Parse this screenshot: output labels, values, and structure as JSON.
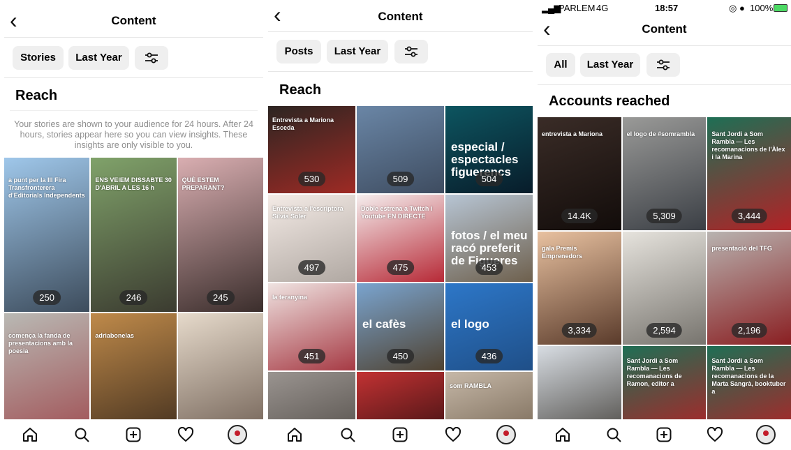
{
  "screens": [
    {
      "title": "Content",
      "filters": [
        "Stories",
        "Last Year"
      ],
      "section": "Reach",
      "note": "Your stories are shown to your audience for 24 hours. After 24 hours, stories appear here so you can view insights. These insights are only visible to you.",
      "tiles": [
        {
          "value": "250",
          "caption": "a punt per la III Fira Transfronterera d'Editorials Independents",
          "big": "",
          "colors": [
            "#9fc7ea",
            "#3d4c5c"
          ]
        },
        {
          "value": "246",
          "caption": "ENS VEIEM DISSABTE 30 D'ABRIL A LES 16 h",
          "big": "",
          "colors": [
            "#80a26a",
            "#3b3b30"
          ]
        },
        {
          "value": "245",
          "caption": "QUÈ ESTEM PREPARANT?",
          "big": "",
          "colors": [
            "#d9aeb1",
            "#3b2e2c"
          ]
        },
        {
          "value": "",
          "caption": "comença la fanda de presentacions amb la poesia",
          "big": "",
          "colors": [
            "#b9b9b4",
            "#9b3b41"
          ]
        },
        {
          "value": "",
          "caption": "adriabonelas",
          "big": "",
          "colors": [
            "#bf8a4a",
            "#2c1f16"
          ]
        },
        {
          "value": "",
          "caption": "",
          "big": "",
          "colors": [
            "#e6dacb",
            "#5b4a3f"
          ]
        }
      ]
    },
    {
      "title": "Content",
      "filters": [
        "Posts",
        "Last Year"
      ],
      "section": "Reach",
      "tiles": [
        {
          "value": "530",
          "caption": "Entrevista a Mariona Esceda",
          "big": "",
          "colors": [
            "#2c2522",
            "#9e2a24"
          ]
        },
        {
          "value": "509",
          "caption": "",
          "big": "",
          "colors": [
            "#6a86a6",
            "#3e4c60"
          ]
        },
        {
          "value": "504",
          "caption": "",
          "big": "especial / espectacles figuerencs",
          "colors": [
            "#0d5560",
            "#081c2a"
          ]
        },
        {
          "value": "497",
          "caption": "Entrevista a l'escriptora Sílvia Soler",
          "big": "",
          "colors": [
            "#f4ebe6",
            "#b0a8a2"
          ]
        },
        {
          "value": "475",
          "caption": "Doble estrena a Twitch i Youtube EN DIRECTE",
          "big": "",
          "colors": [
            "#f5eeee",
            "#b72a37"
          ]
        },
        {
          "value": "453",
          "caption": "",
          "big": "fotos / el meu racó preferit de Figueres",
          "colors": [
            "#b7c5d4",
            "#6e604d"
          ]
        },
        {
          "value": "451",
          "caption": "la teranyina",
          "big": "",
          "colors": [
            "#efe3e1",
            "#a63a44"
          ]
        },
        {
          "value": "450",
          "caption": "",
          "big": "el cafès",
          "colors": [
            "#7aa4cf",
            "#4f4231"
          ]
        },
        {
          "value": "436",
          "caption": "",
          "big": "el logo",
          "colors": [
            "#2d77c8",
            "#1f4f88"
          ]
        },
        {
          "value": "",
          "caption": "",
          "big": "",
          "colors": [
            "#9a9490",
            "#4a4540"
          ]
        },
        {
          "value": "",
          "caption": "",
          "big": "",
          "colors": [
            "#c23233",
            "#260b0c"
          ]
        },
        {
          "value": "",
          "caption": "som RAMBLA",
          "big": "",
          "colors": [
            "#c6b8a8",
            "#6a5a47"
          ]
        }
      ]
    },
    {
      "status": {
        "carrier": "PARLEM",
        "network": "4G",
        "time": "18:57",
        "battery": "100%"
      },
      "title": "Content",
      "filters": [
        "All",
        "Last Year"
      ],
      "section": "Accounts reached",
      "tiles": [
        {
          "value": "14.4K",
          "caption": "entrevista a Mariona",
          "big": "",
          "colors": [
            "#3a2c27",
            "#120c0a"
          ]
        },
        {
          "value": "5,309",
          "caption": "el logo de #somrambla",
          "big": "",
          "colors": [
            "#9a9a98",
            "#3b3f45"
          ]
        },
        {
          "value": "3,444",
          "caption": "Sant Jordi a Som Rambla — Les recomanacions de l'Àlex i la Marina",
          "big": "",
          "colors": [
            "#1e6f55",
            "#b22226"
          ]
        },
        {
          "value": "3,334",
          "caption": "gala Premis Emprenedors",
          "big": "",
          "colors": [
            "#e8c1a0",
            "#5a3b2b"
          ]
        },
        {
          "value": "2,594",
          "caption": "",
          "big": "",
          "colors": [
            "#e6e3dd",
            "#77746e"
          ]
        },
        {
          "value": "2,196",
          "caption": "presentació del TFG",
          "big": "",
          "colors": [
            "#b8b3b0",
            "#8a1f22"
          ]
        },
        {
          "value": "",
          "caption": "",
          "big": "",
          "colors": [
            "#d8dde3",
            "#4d4a45"
          ]
        },
        {
          "value": "",
          "caption": "Sant Jordi a Som Rambla — Les recomanacions de Ramon, editor a",
          "big": "",
          "colors": [
            "#1e6f55",
            "#b22226"
          ]
        },
        {
          "value": "",
          "caption": "Sant Jordi a Som Rambla — Les recomanacions de la Marta Sangrà, booktuber a",
          "big": "",
          "colors": [
            "#1e6f55",
            "#b22226"
          ]
        }
      ]
    }
  ]
}
